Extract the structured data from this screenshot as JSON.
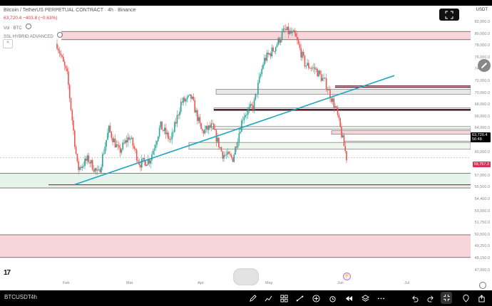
{
  "header": {
    "symbol_title": "Bitcoin / TetherUS PERPETUAL CONTRACT · 4h · Binance",
    "ohlc_line": "63,720.4 −403.8 (−0.63%)",
    "vol_label": "Vol · BTC",
    "indicator_label": "SSL HYBRID ADVANCED",
    "currency": "USDT"
  },
  "price_axis": {
    "ticks": [
      "82,000.0",
      "80,000.0",
      "78,000.0",
      "76,000.0",
      "74,000.0",
      "72,000.0",
      "70,000.0",
      "68,000.0",
      "66,000.0",
      "64,000.0",
      "62,000.0",
      "60,000.0",
      "58,500.0",
      "57,000.0",
      "55,500.0",
      "54,400.0",
      "53,000.0",
      "51,750.0",
      "50,500.0",
      "49,250.0",
      "48,150.0",
      "47,000.0"
    ],
    "current_price": "63,720.4",
    "countdown": "56:48",
    "line_price": "59,757.3"
  },
  "time_axis": {
    "labels": [
      "Feb",
      "Mar",
      "Apr",
      "May",
      "Jun",
      "Jul"
    ]
  },
  "bottom_bar": {
    "ticker": "BTCUSDT",
    "interval": "4h"
  },
  "colors": {
    "background": "#ffffff",
    "up": "#26a69a",
    "down": "#ef5350",
    "trendline": "#22a5c0",
    "red_zone": "#f8d5d8",
    "green_zone": "#e6f3ea",
    "price_badge": "#000000",
    "level_badge": "#d5325a"
  },
  "chart_data": {
    "type": "candlestick",
    "currency": "USDT",
    "interval": "4h",
    "time_labels": [
      "Feb",
      "Mar",
      "Apr",
      "May",
      "Jun",
      "Jul"
    ],
    "approx_closes": [
      80200,
      75500,
      62000,
      63500,
      61200,
      67800,
      64500,
      66800,
      62800,
      63400,
      68300,
      66100,
      71700,
      72400,
      67400,
      68200,
      64200,
      63600,
      69800,
      71200,
      77800,
      79500,
      82200,
      81400,
      77200,
      76500,
      74400,
      70600,
      63720
    ],
    "current_price": 63720.4,
    "change": -403.8,
    "change_pct": -0.63,
    "marked_level": 59757.3,
    "ylim": [
      46500,
      84500
    ],
    "zones": [
      {
        "color": "red",
        "from": 80800,
        "to": 82000
      },
      {
        "color": "red",
        "from": 49200,
        "to": 52500
      },
      {
        "color": "green",
        "from": 59300,
        "to": 61400
      }
    ],
    "trendline": [
      {
        "x": "early Feb",
        "y": 59757
      },
      {
        "x": "mid Jun",
        "y": 75600
      }
    ]
  }
}
